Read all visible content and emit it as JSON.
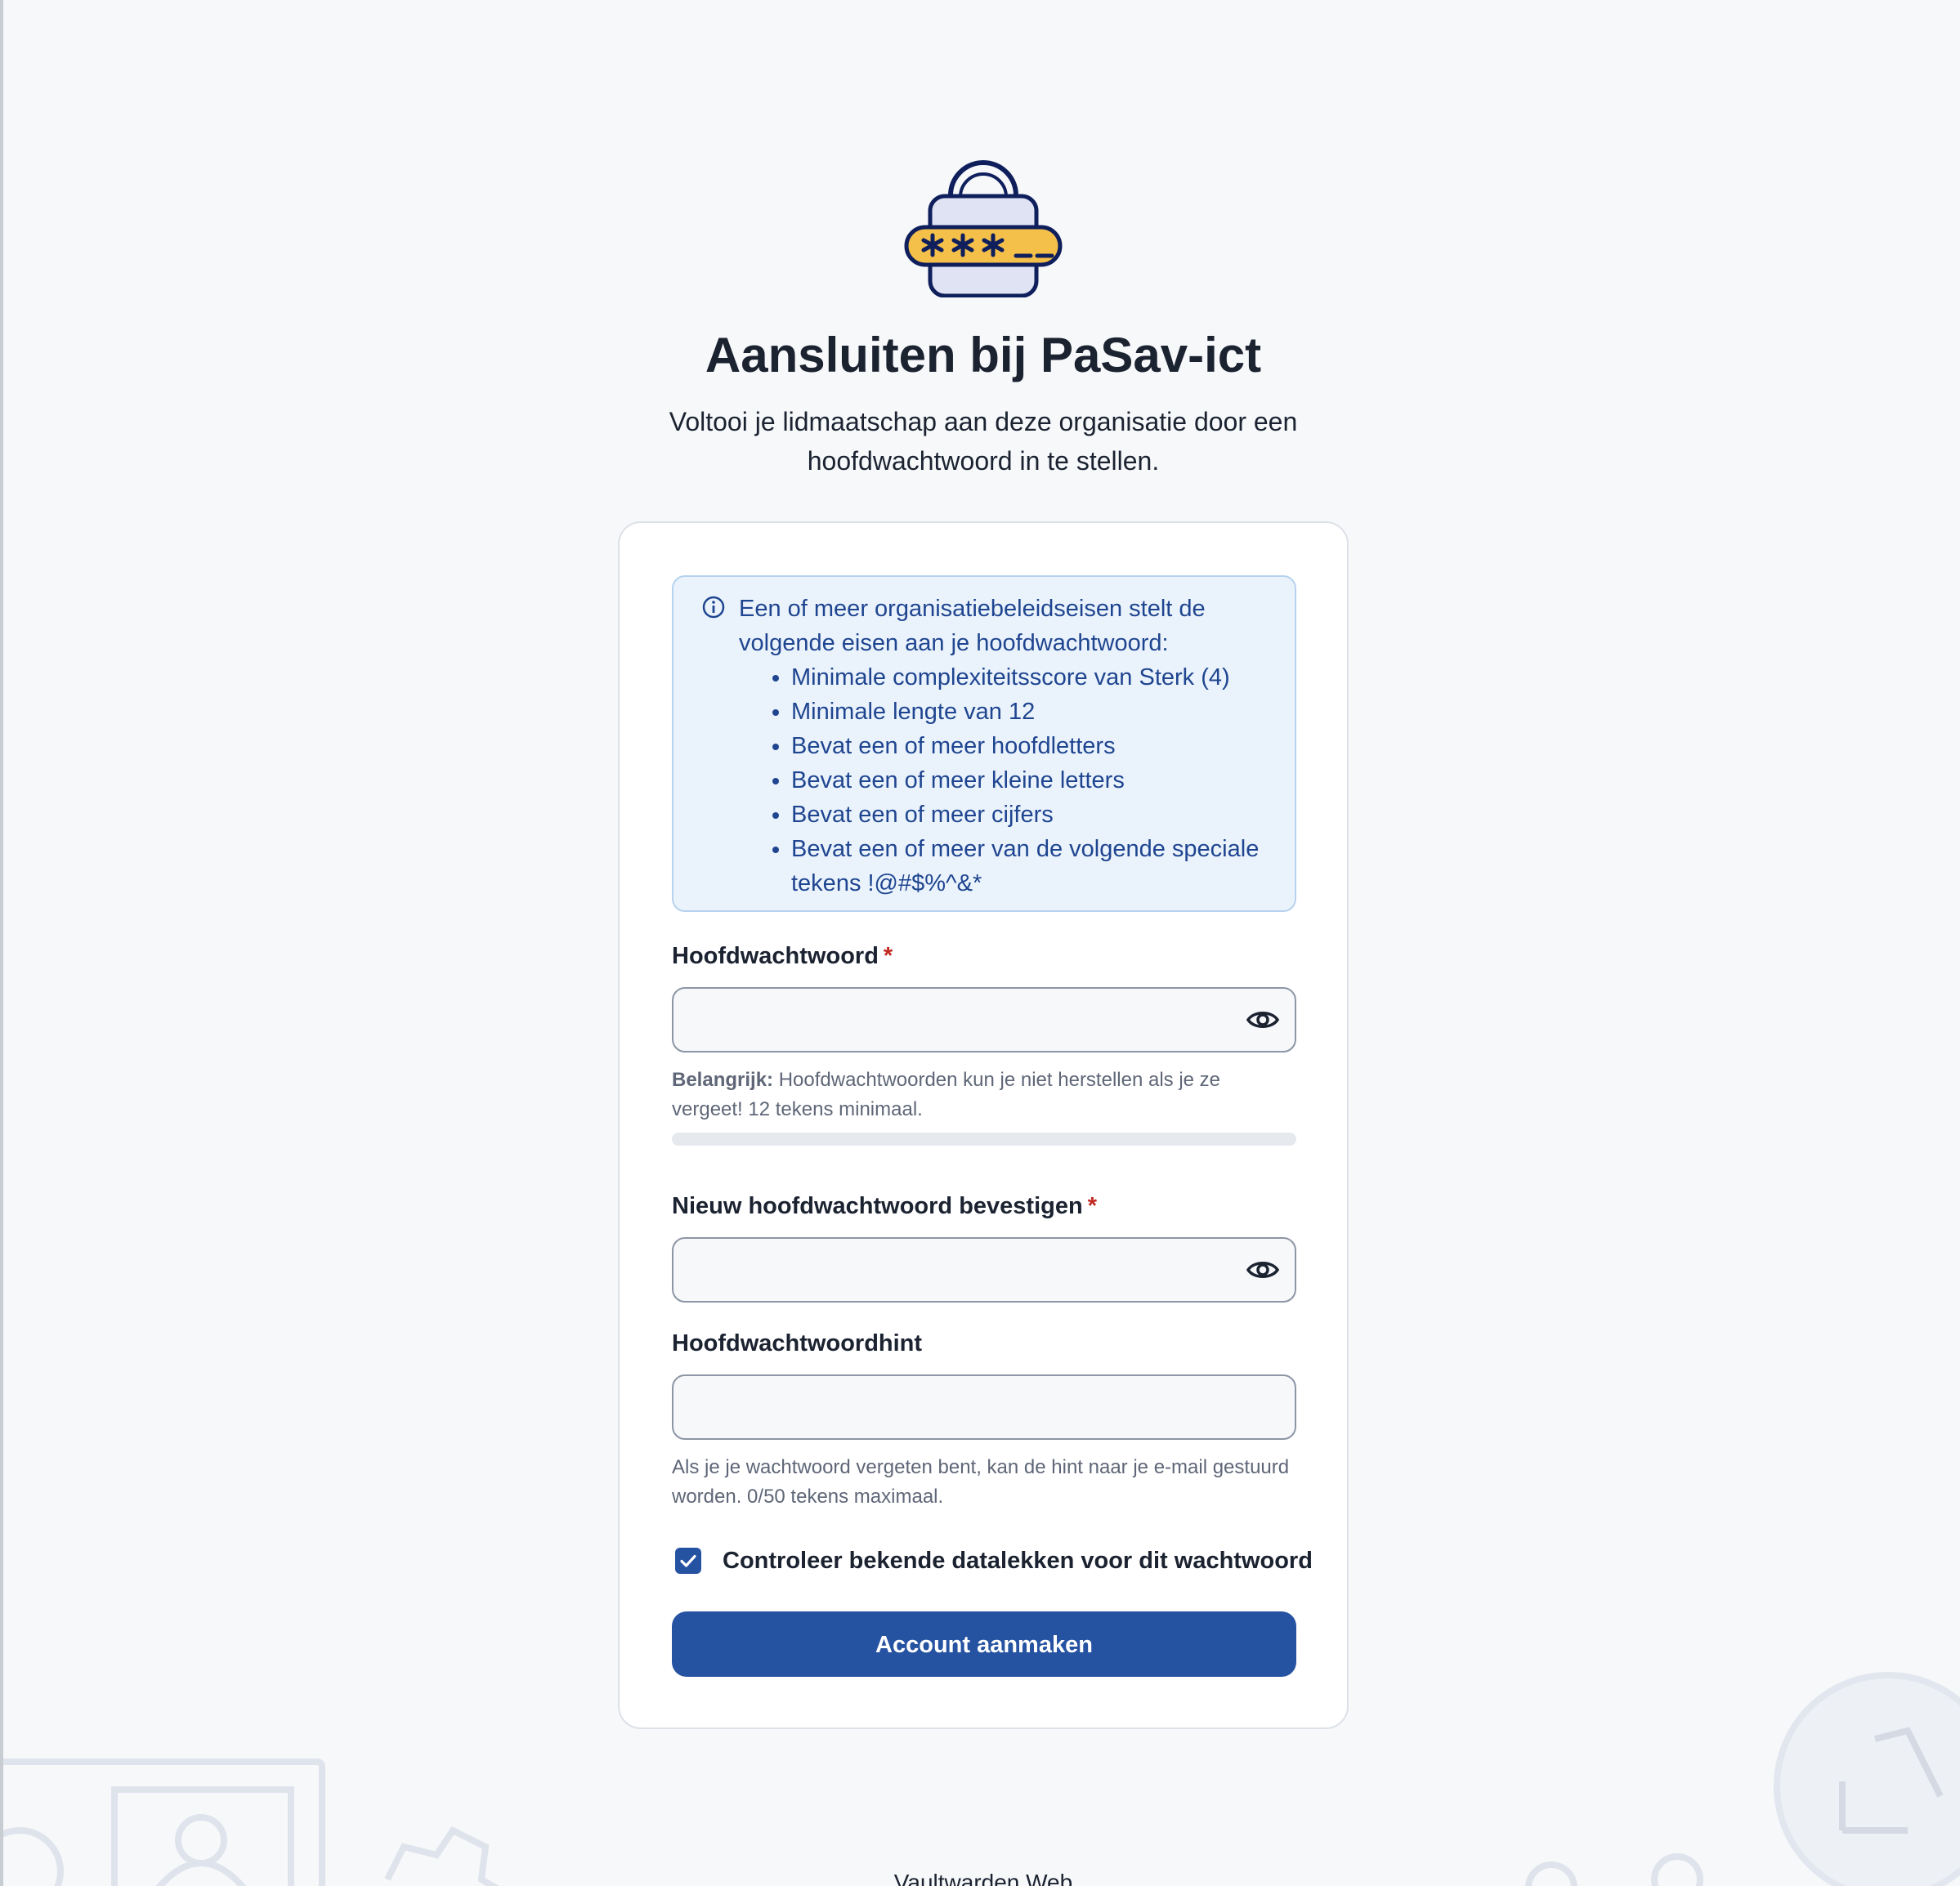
{
  "header": {
    "logo_icon": "lock-password-icon",
    "title": "Aansluiten bij PaSav-ict",
    "subtitle": "Voltooi je lidmaatschap aan deze organisatie door een hoofdwachtwoord in te stellen."
  },
  "policy": {
    "icon": "info-icon",
    "intro": "Een of meer organisatiebeleidseisen stelt de volgende eisen aan je hoofdwachtwoord:",
    "items": [
      "Minimale complexiteitsscore van Sterk (4)",
      "Minimale lengte van 12",
      "Bevat een of meer hoofdletters",
      "Bevat een of meer kleine letters",
      "Bevat een of meer cijfers",
      "Bevat een of meer van de volgende speciale tekens !@#$%^&*"
    ]
  },
  "master_password": {
    "label": "Hoofdwachtwoord",
    "required_marker": "*",
    "value": "",
    "toggle_icon": "eye-icon",
    "help_strong": "Belangrijk:",
    "help_text": " Hoofdwachtwoorden kun je niet herstellen als je ze vergeet! 12 tekens minimaal.",
    "strength_fraction": 0
  },
  "confirm_password": {
    "label": "Nieuw hoofdwachtwoord bevestigen",
    "required_marker": "*",
    "value": "",
    "toggle_icon": "eye-icon"
  },
  "hint": {
    "label": "Hoofdwachtwoordhint",
    "value": "",
    "help_text": "Als je je wachtwoord vergeten bent, kan de hint naar je e-mail gestuurd worden. 0/50 tekens maximaal."
  },
  "breach_check": {
    "checked": true,
    "label": "Controleer bekende datalekken voor dit wachtwoord"
  },
  "submit": {
    "label": "Account aanmaken"
  },
  "footer": {
    "text": "Vaultwarden Web"
  },
  "colors": {
    "primary": "#2552a1",
    "background": "#f6f8fa",
    "callout_bg": "#eaf3fc",
    "callout_text": "#1f4590",
    "required": "#c0271f",
    "lock_body": "#dfe3f3",
    "lock_band": "#f5c04a",
    "lock_outline": "#0f1f5c"
  }
}
